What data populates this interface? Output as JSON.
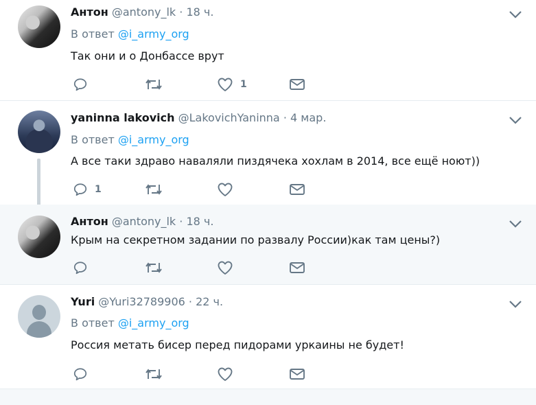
{
  "tweets": [
    {
      "name": "Антон",
      "handle": "@antony_lk",
      "dot": "·",
      "time": "18 ч.",
      "reply_prefix": "В ответ",
      "reply_mention": "@i_army_org",
      "text": "Так они и о Донбассе врут",
      "likes": "1",
      "replies": ""
    },
    {
      "name": "yaninna lakovich",
      "handle": "@LakovichYaninna",
      "dot": "·",
      "time": "4 мар.",
      "reply_prefix": "В ответ",
      "reply_mention": "@i_army_org",
      "text": "А все таки здраво наваляли пиздячека хохлам в 2014, все ещё ноют))",
      "likes": "",
      "replies": "1"
    },
    {
      "name": "Антон",
      "handle": "@antony_lk",
      "dot": "·",
      "time": "18 ч.",
      "text": "Крым на секретном задании по развалу России)как там цены?)",
      "likes": "",
      "replies": ""
    },
    {
      "name": "Yuri",
      "handle": "@Yuri32789906",
      "dot": "·",
      "time": "22 ч.",
      "reply_prefix": "В ответ",
      "reply_mention": "@i_army_org",
      "text": "Россия метать бисер перед пидорами  уркаины не будет!",
      "likes": "",
      "replies": ""
    }
  ],
  "icons": [
    "reply-icon",
    "retweet-icon",
    "like-icon",
    "message-icon",
    "chevron-down-icon"
  ],
  "colors": {
    "link": "#1da1f2",
    "muted": "#657786",
    "highlight_bg": "#f5f8fa",
    "separator": "#e6ecf0"
  }
}
